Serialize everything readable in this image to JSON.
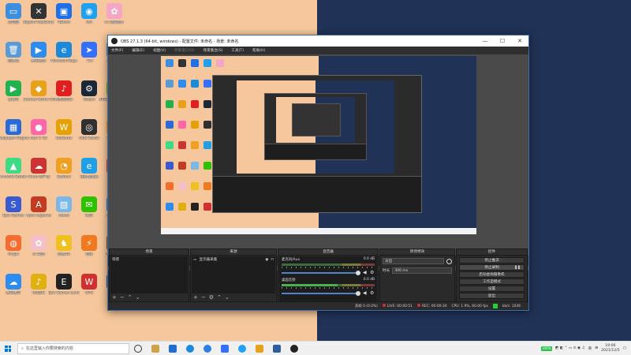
{
  "desktop": {
    "icons": [
      {
        "label": "此电脑",
        "color": "#3b8ee0",
        "glyph": "▭"
      },
      {
        "label": "Bigsoft WebDiary",
        "color": "#333333",
        "glyph": "✕"
      },
      {
        "label": "ToDesk",
        "color": "#1e6fe8",
        "glyph": "▣"
      },
      {
        "label": "QQ",
        "color": "#1fa0f0",
        "glyph": "◉"
      },
      {
        "label": "cc 动漫图片",
        "color": "#f4a6c4",
        "glyph": "✿"
      },
      {
        "label": "回收站",
        "color": "#5b9bd5",
        "glyph": "🗑"
      },
      {
        "label": "腾讯视频",
        "color": "#2d8cf0",
        "glyph": "▶"
      },
      {
        "label": "Microsoft Edge",
        "color": "#1c8adb",
        "glyph": "e"
      },
      {
        "label": "飞书",
        "color": "#3370ff",
        "glyph": "➤"
      },
      {
        "label": "控制面板",
        "color": "#4a90d9",
        "glyph": "▤"
      },
      {
        "label": "爱奇艺",
        "color": "#22b14c",
        "glyph": "▶"
      },
      {
        "label": "Counter-Strike Global Offensive",
        "color": "#e8a21a",
        "glyph": "◆"
      },
      {
        "label": "网易云音乐",
        "color": "#e02020",
        "glyph": "♪"
      },
      {
        "label": "Steam",
        "color": "#1b2838",
        "glyph": "⚙"
      },
      {
        "label": "NVIDIA Experience",
        "color": "#76b900",
        "glyph": "◣"
      },
      {
        "label": "Wallpaper Engine",
        "color": "#2a6ad6",
        "glyph": "▦"
      },
      {
        "label": "osu! 2 Tai",
        "color": "#ff66aa",
        "glyph": "●"
      },
      {
        "label": "WeGame",
        "color": "#e6a100",
        "glyph": "W"
      },
      {
        "label": "OBS Studio",
        "color": "#303030",
        "glyph": "◎"
      },
      {
        "label": "哔哩哔哩",
        "color": "#f7a300",
        "glyph": "▶"
      },
      {
        "label": "Android Studio",
        "color": "#3ddc84",
        "glyph": "▲"
      },
      {
        "label": "Cloud 客户端",
        "color": "#cc3333",
        "glyph": "☁"
      },
      {
        "label": "DaVinci",
        "color": "#f0a020",
        "glyph": "◔"
      },
      {
        "label": "夜神模拟器",
        "color": "#1e9fe6",
        "glyph": "e"
      },
      {
        "label": "Spark",
        "color": "#d04040",
        "glyph": "▲"
      },
      {
        "label": "Epic Games",
        "color": "#3a5bd0",
        "glyph": "S"
      },
      {
        "label": "Apex Legends",
        "color": "#c23b22",
        "glyph": "A"
      },
      {
        "label": "seeds",
        "color": "#7ab8e8",
        "glyph": "▧"
      },
      {
        "label": "微信",
        "color": "#2dc100",
        "glyph": "✉"
      },
      {
        "label": "腾讯会议",
        "color": "#2d7fe6",
        "glyph": "◐"
      },
      {
        "label": "Origin",
        "color": "#f56c2d",
        "glyph": "◍"
      },
      {
        "label": "cc 漫画",
        "color": "#f4c0c8",
        "glyph": "✿"
      },
      {
        "label": "网易UU",
        "color": "#f0c020",
        "glyph": "♞"
      },
      {
        "label": "迅雷",
        "color": "#f07a20",
        "glyph": "⚡"
      },
      {
        "label": "Minecraft",
        "color": "#7a5c2e",
        "glyph": "▦"
      },
      {
        "label": "腾讯课堂",
        "color": "#2d8cf0",
        "glyph": "☁"
      },
      {
        "label": "QQ音乐",
        "color": "#e0b010",
        "glyph": "♪"
      },
      {
        "label": "Epic Games Launcher",
        "color": "#222222",
        "glyph": "E"
      },
      {
        "label": "WPS",
        "color": "#d03030",
        "glyph": "W"
      },
      {
        "label": "Word",
        "color": "#2b579a",
        "glyph": "W"
      }
    ]
  },
  "obs": {
    "title": "OBS 27.1.3 (64-bit, windows) - 配置文件: 未命名 - 场景: 未命名",
    "window_controls": [
      "—",
      "☐",
      "✕"
    ],
    "menu": [
      "文件(F)",
      "编辑(E)",
      "视图(V)",
      "停靠窗口(D)",
      "场景集合(S)",
      "工具(T)",
      "帮助(H)"
    ],
    "filter_label": "未选择源",
    "filter_buttons": [
      "属性",
      "滤镜"
    ],
    "docks": {
      "scenes": {
        "title": "场景",
        "items": [
          "场景"
        ]
      },
      "sources": {
        "title": "来源",
        "items": [
          "显示器采集"
        ]
      },
      "mixer": {
        "title": "混音器",
        "channels": [
          {
            "name": "麦克风/Aux",
            "db": "0.0 dB"
          },
          {
            "name": "桌面音频",
            "db": "0.0 dB"
          }
        ]
      },
      "transitions": {
        "title": "转场特效",
        "mode": "淡出",
        "duration_label": "时长",
        "duration_value": "300 ms"
      },
      "controls": {
        "title": "控件",
        "buttons": [
          "停止推流",
          "停止录制",
          "启动虚拟摄像机",
          "工作室模式",
          "设置",
          "退出"
        ],
        "pause_glyph": "❚❚"
      }
    },
    "status": {
      "dropped": "丢帧 0 (0.0%)",
      "live_label": "LIVE:",
      "live_time": "00:00:51",
      "rec_label": "REC:",
      "rec_time": "00:00:30",
      "cpu": "CPU: 1.9%, 60.00 fps",
      "bitrate": "kb/s: 1036"
    }
  },
  "taskbar": {
    "search_placeholder": "在这里输入你要搜索的内容",
    "battery": "100%",
    "time": "19:06",
    "date": "2021/12/5",
    "lang": "英"
  }
}
